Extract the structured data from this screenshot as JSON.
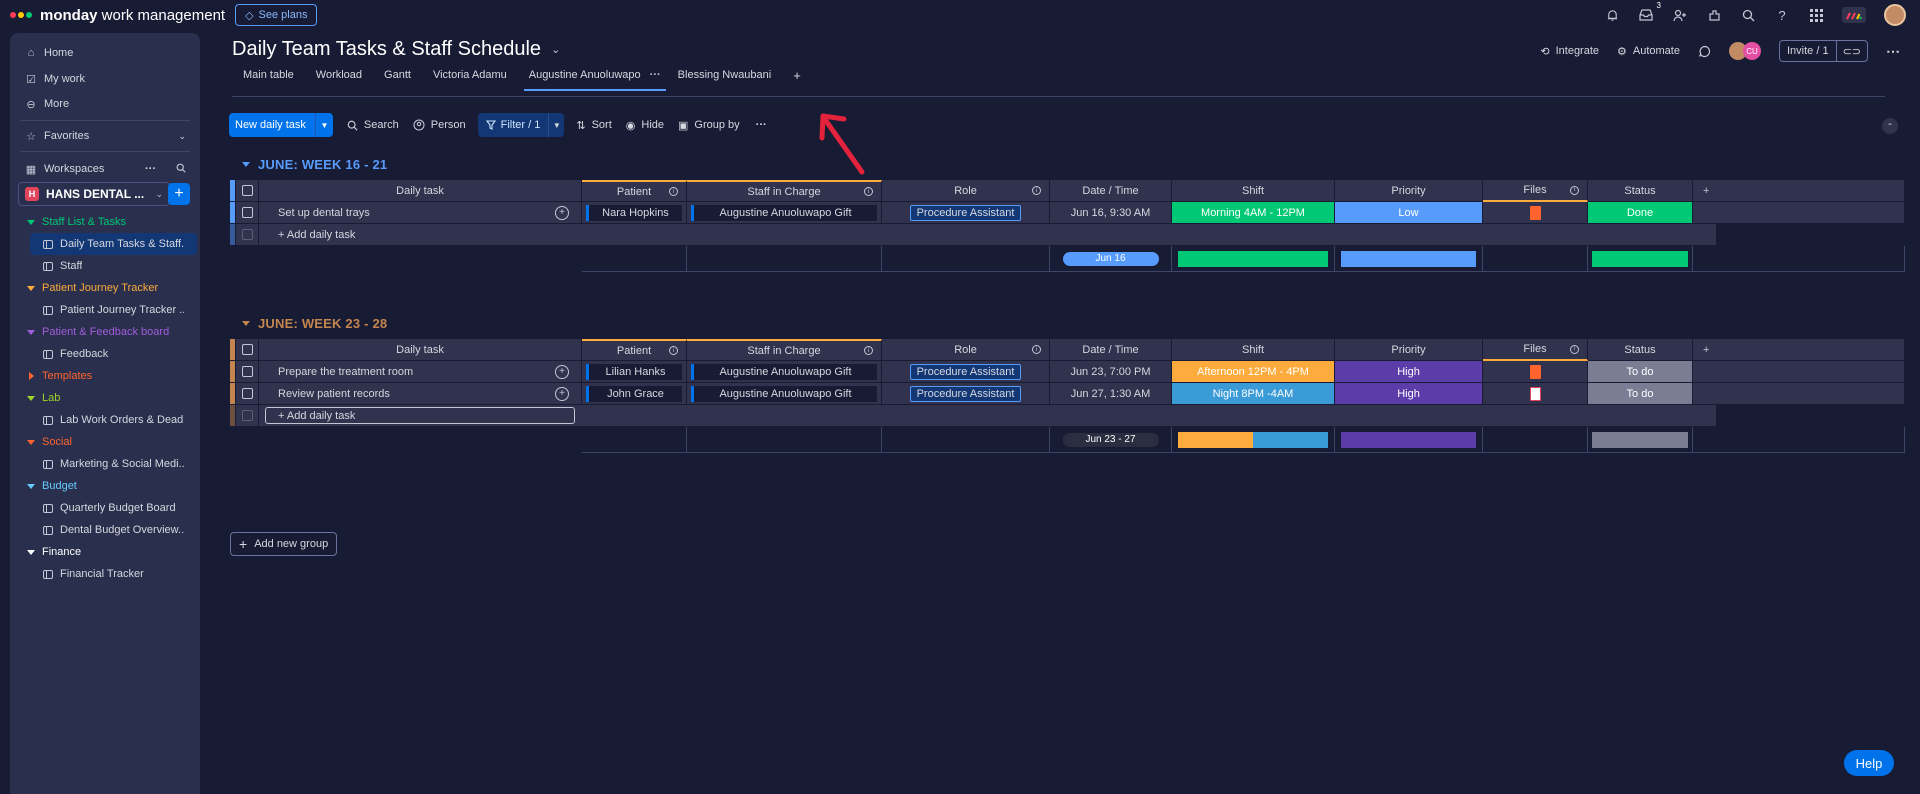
{
  "app": {
    "logo_bold": "monday",
    "logo_rest": " work management",
    "see_plans": "See plans",
    "inbox_badge": "3",
    "logo_dot_colors": [
      "#ff3d57",
      "#ffcb00",
      "#00ca72"
    ]
  },
  "sidebar": {
    "home": "Home",
    "my_work": "My work",
    "more": "More",
    "favorites": "Favorites",
    "workspaces": "Workspaces",
    "workspace_badge": "H",
    "workspace_name": "HANS DENTAL ...",
    "folders": [
      {
        "label": "Staff List & Tasks",
        "color": "#00c875",
        "boards": [
          "Daily Team Tasks & Staff...",
          "Staff"
        ]
      },
      {
        "label": "Patient Journey Tracker",
        "color": "#fdab3d",
        "boards": [
          "Patient Journey Tracker ..."
        ]
      },
      {
        "label": "Patient & Feedback board",
        "color": "#a25ddc",
        "boards": [
          "Feedback"
        ]
      },
      {
        "label": "Templates",
        "color": "#ff642e",
        "boards": []
      },
      {
        "label": "Lab",
        "color": "#9cd326",
        "boards": [
          "Lab Work Orders & Dead..."
        ]
      },
      {
        "label": "Social",
        "color": "#ff642e",
        "boards": [
          "Marketing & Social Medi..."
        ]
      },
      {
        "label": "Budget",
        "color": "#66ccff",
        "boards": [
          "Quarterly Budget Board",
          "Dental Budget Overview..."
        ]
      },
      {
        "label": "Finance",
        "color": "#ffffff",
        "boards": [
          "Financial Tracker"
        ]
      }
    ]
  },
  "header": {
    "title": "Daily Team Tasks & Staff Schedule",
    "integrate": "Integrate",
    "automate": "Automate",
    "avatar_initials": "CU",
    "invite": "Invite / 1"
  },
  "tabs": [
    "Main table",
    "Workload",
    "Gantt",
    "Victoria Adamu",
    "Augustine Anuoluwapo",
    "Blessing Nwaubani",
    "+"
  ],
  "toolbar": {
    "new_task": "New daily task",
    "search": "Search",
    "person": "Person",
    "filter": "Filter / 1",
    "sort": "Sort",
    "hide": "Hide",
    "group_by": "Group by"
  },
  "columns": {
    "task": "Daily task",
    "patient": "Patient",
    "staff": "Staff in Charge",
    "role": "Role",
    "date": "Date / Time",
    "shift": "Shift",
    "priority": "Priority",
    "files": "Files",
    "status": "Status"
  },
  "groups": [
    {
      "title": "JUNE: WEEK 16 - 21",
      "color": "#579bfc",
      "rows": [
        {
          "task": "Set up dental trays",
          "patient": "Nara Hopkins",
          "staff": "Augustine Anuoluwapo Gift",
          "role": "Procedure Assistant",
          "date": "Jun 16, 9:30 AM",
          "shift": "Morning 4AM - 12PM",
          "shift_color": "#00c875",
          "priority": "Low",
          "priority_color": "#579bfc",
          "file_color": "#ff642e",
          "status": "Done",
          "status_color": "#00c875"
        }
      ],
      "add_task": "+ Add daily task",
      "summary_date": "Jun 16",
      "summary_date_color": "#579bfc"
    },
    {
      "title": "JUNE: WEEK 23 - 28",
      "color": "#c4854f",
      "rows": [
        {
          "task": "Prepare the treatment room",
          "patient": "Lilian Hanks",
          "staff": "Augustine Anuoluwapo Gift",
          "role": "Procedure Assistant",
          "date": "Jun 23, 7:00 PM",
          "shift": "Afternoon 12PM - 4PM",
          "shift_color": "#fdab3d",
          "priority": "High",
          "priority_color": "#5c3ca8",
          "file_color": "#ff642e",
          "status": "To do",
          "status_color": "#7a7e95"
        },
        {
          "task": "Review patient records",
          "patient": "John Grace",
          "staff": "Augustine Anuoluwapo Gift",
          "role": "Procedure Assistant",
          "date": "Jun 27, 1:30 AM",
          "shift": "Night 8PM -4AM",
          "shift_color": "#3a9bd6",
          "priority": "High",
          "priority_color": "#5c3ca8",
          "file_color": "#ffffff",
          "status": "To do",
          "status_color": "#7a7e95"
        }
      ],
      "add_task": "+ Add daily task",
      "summary_date": "Jun 23 - 27",
      "summary_date_color": "#2b2d40"
    }
  ],
  "add_group": "Add new group",
  "help": "Help"
}
